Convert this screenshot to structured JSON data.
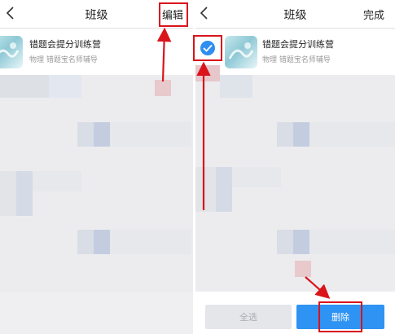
{
  "left_screen": {
    "nav": {
      "title": "班级",
      "action": "编辑"
    },
    "item": {
      "title": "错题会提分训练营",
      "subtitle": "物理 错题宝名师辅导"
    }
  },
  "right_screen": {
    "nav": {
      "title": "班级",
      "action": "完成"
    },
    "item": {
      "title": "错题会提分训练营",
      "subtitle": "物理  错题宝名师辅导",
      "selected": true
    },
    "buttons": {
      "select_all": "全选",
      "delete": "删除"
    }
  },
  "icons": {
    "back": "back-chevron-icon",
    "check": "checkmark-icon",
    "avatar": "class-avatar-icon"
  },
  "colors": {
    "accent": "#2f93f4",
    "annotation": "#d9141b",
    "disabled_button": "#e4e6ea"
  }
}
